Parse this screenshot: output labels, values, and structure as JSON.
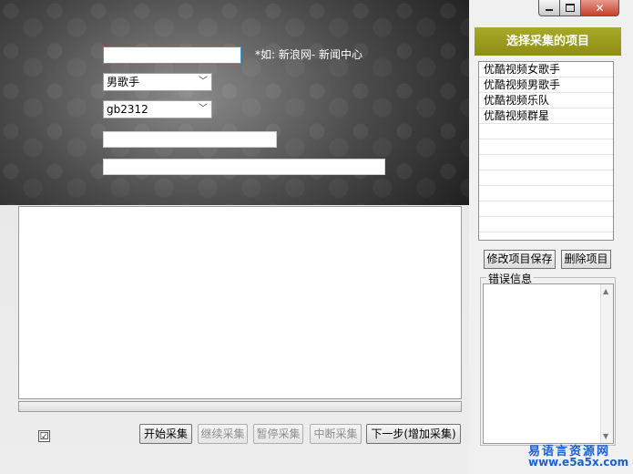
{
  "window": {
    "minimize": "–",
    "maximize": "□",
    "close": "✕"
  },
  "form": {
    "url_input_value": "",
    "hint": "*如: 新浪网- 新闻中心",
    "category_select": "男歌手",
    "encoding_select": "gb2312",
    "field3_value": "",
    "field4_value": ""
  },
  "log": {
    "text": ""
  },
  "controls": {
    "checkbox_mark": "☑",
    "start_label": "开始采集",
    "continue_label": "继续采集",
    "pause_label": "暂停采集",
    "abort_label": "中断采集",
    "next_label": "下一步(增加采集)"
  },
  "right_panel": {
    "header": "选择采集的项目",
    "items": [
      "优酷视频女歌手",
      "优酷视频男歌手",
      "优酷视频乐队",
      "优酷视频群星"
    ],
    "save_label": "修改项目保存",
    "delete_label": "删除项目",
    "error_group_label": "错误信息",
    "error_text": ""
  },
  "watermark": {
    "line1": "易语言资源网",
    "line2": "www.e5a5x.com"
  }
}
